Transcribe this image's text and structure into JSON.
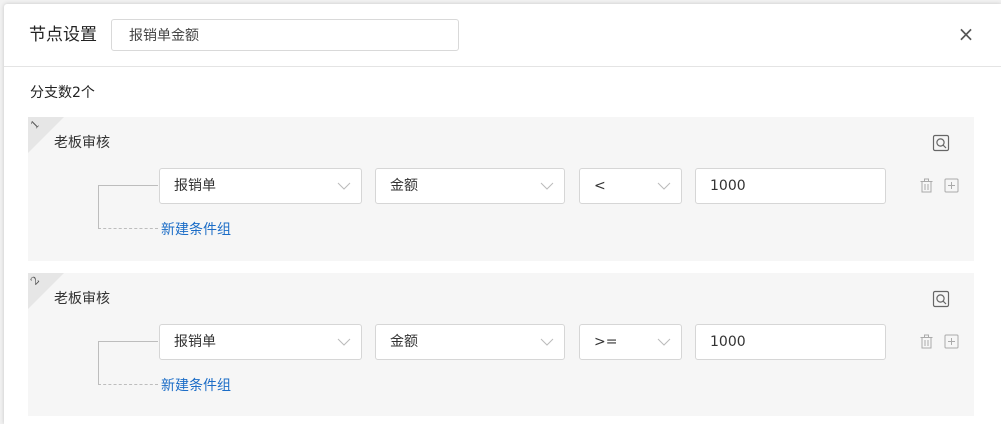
{
  "dialog": {
    "title": "节点设置",
    "node_name_value": "报销单金额",
    "close_label": "×"
  },
  "branch_count_label": "分支数2个",
  "branches": [
    {
      "index": "1",
      "node_title": "老板审核",
      "condition": {
        "form": "报销单",
        "field": "金额",
        "operator": "<",
        "value": "1000"
      },
      "new_group_label": "新建条件组"
    },
    {
      "index": "2",
      "node_title": "老板审核",
      "condition": {
        "form": "报销单",
        "field": "金额",
        "operator": ">=",
        "value": "1000"
      },
      "new_group_label": "新建条件组"
    }
  ],
  "colors": {
    "link": "#1c6dc7",
    "panel_bg": "#f6f6f6",
    "border": "#d6d6d6"
  }
}
